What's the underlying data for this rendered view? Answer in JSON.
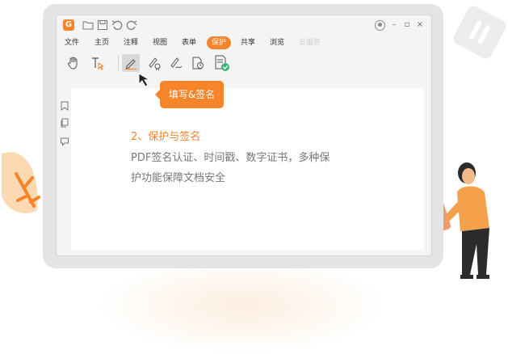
{
  "titlebar": {
    "app_logo": "G",
    "quick_access": [
      "open-folder-icon",
      "save-icon",
      "undo-icon",
      "redo-icon"
    ],
    "window_controls": [
      "user-icon",
      "minimize-icon",
      "maximize-icon",
      "close-icon"
    ]
  },
  "menu": {
    "items": [
      "文件",
      "主页",
      "注释",
      "视图",
      "表单",
      "保护",
      "共享",
      "浏览",
      "云服务"
    ],
    "active_index": 5
  },
  "toolbar": {
    "tools": [
      "hand-tool-icon",
      "select-text-icon",
      "fill-sign-icon",
      "certify-icon",
      "sign-icon",
      "timestamp-icon",
      "validate-icon"
    ],
    "selected": "fill-sign-icon"
  },
  "sidebar": {
    "icons": [
      "bookmark-icon",
      "pages-icon",
      "comments-icon"
    ]
  },
  "tooltip": {
    "label": "填写&签名"
  },
  "feature": {
    "heading": "2、保护与签名",
    "line1": "PDF签名认证、时间戳、数字证书，多种保",
    "line2": "护功能保障文档安全"
  },
  "colors": {
    "accent": "#f5842a",
    "text_body": "#777777",
    "device_frame": "#e4e4e4"
  }
}
